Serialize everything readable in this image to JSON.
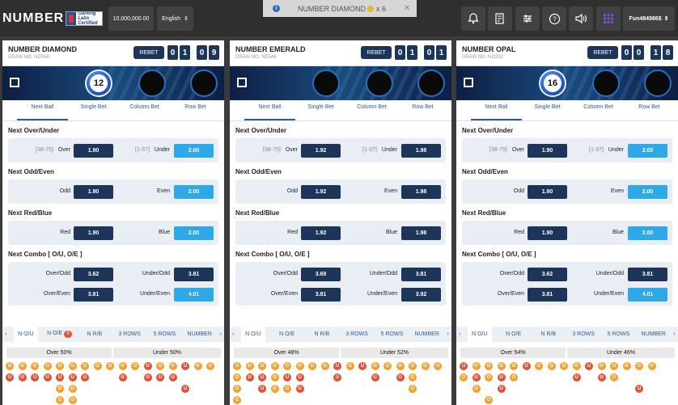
{
  "header": {
    "logo_text": "NUMBER",
    "logo_badge_lines": [
      "Gaming",
      "Labs",
      "Certified"
    ],
    "balance": "10,000,000.00",
    "language": "English",
    "username": "Fun484986$",
    "toast": {
      "text": "NUMBER DIAMOND",
      "multiplier": "x 6"
    },
    "icons": [
      "bell-icon",
      "bet-slip-icon",
      "settings-sliders-icon",
      "help-icon",
      "volume-icon",
      "grid-icon"
    ]
  },
  "tabs": [
    "Next Ball",
    "Single Bet",
    "Column Bet",
    "Row Bet"
  ],
  "sections": {
    "ou": "Next Over/Under",
    "oe": "Next Odd/Even",
    "rb": "Next Red/Blue",
    "combo": "Next Combo [ O/U, O/E ]"
  },
  "labels": {
    "over_range": "[38-75]",
    "over": "Over",
    "under_range": "[1-37]",
    "under": "Under",
    "odd": "Odd",
    "even": "Even",
    "red": "Red",
    "blue": "Blue",
    "over_odd": "Over/Odd",
    "under_odd": "Under/Odd",
    "over_even": "Over/Even",
    "under_even": "Under/Even"
  },
  "rebet": "REBET",
  "bottom_tabs": [
    "N O/U",
    "N O/E",
    "N R/B",
    "3 ROWS",
    "5 ROWS",
    "NUMBER"
  ],
  "panels": [
    {
      "name": "NUMBER DIAMOND",
      "draw_no": "DRAW NO. ND566",
      "timer": [
        "0",
        "1",
        "0",
        "9"
      ],
      "balls": [
        "12",
        "",
        ""
      ],
      "odds": {
        "over": "1.90",
        "under": "2.00",
        "odd": "1.90",
        "even": "2.00",
        "red": "1.90",
        "blue": "2.00",
        "over_odd": "3.62",
        "under_odd": "3.81",
        "over_even": "3.81",
        "under_even": "4.01"
      },
      "highlight": [
        "under",
        "even",
        "blue",
        "under_even"
      ],
      "oe_badge": "6",
      "over_stat": "Over 50%",
      "under_stat": "Under 50%",
      "beads": [
        [
          "O",
          "O",
          "O",
          "O",
          "O",
          "O",
          "O",
          "O",
          "O",
          "O",
          "O",
          "U",
          "O",
          "O",
          "U",
          "O",
          "O"
        ],
        [
          "U",
          "U",
          "U",
          "U",
          "U",
          "U",
          "U",
          "",
          "",
          "U",
          "",
          "U",
          "U",
          "U"
        ],
        [
          "",
          "",
          "",
          "",
          "O",
          "O",
          "",
          "",
          "",
          "",
          "",
          "",
          "",
          "",
          "U"
        ],
        [
          "",
          "",
          "",
          "",
          "O",
          "O"
        ]
      ]
    },
    {
      "name": "NUMBER EMERALD",
      "draw_no": "DRAW NO. NE546",
      "timer": [
        "0",
        "1",
        "0",
        "1"
      ],
      "balls": [
        "",
        "",
        ""
      ],
      "odds": {
        "over": "1.92",
        "under": "1.98",
        "odd": "1.92",
        "even": "1.98",
        "red": "1.92",
        "blue": "1.98",
        "over_odd": "3.69",
        "under_odd": "3.81",
        "over_even": "3.81",
        "under_even": "3.92"
      },
      "highlight": [],
      "oe_badge": "",
      "over_stat": "Over 48%",
      "under_stat": "Under 52%",
      "beads": [
        [
          "O",
          "O",
          "O",
          "O",
          "O",
          "O",
          "O",
          "O",
          "U",
          "O",
          "U",
          "O",
          "O",
          "O",
          "O",
          "O",
          "O"
        ],
        [
          "O",
          "U",
          "U",
          "O",
          "U",
          "U",
          "",
          "",
          "U",
          "",
          "",
          "U",
          "",
          "U",
          "O"
        ],
        [
          "O",
          "",
          "U",
          "O",
          "O",
          "U",
          "",
          "",
          "",
          "",
          "",
          "",
          "",
          "",
          "O"
        ],
        [
          "O"
        ]
      ]
    },
    {
      "name": "NUMBER OPAL",
      "draw_no": "DRAW NO. NO292",
      "timer": [
        "0",
        "0",
        "1",
        "8"
      ],
      "balls": [
        "16",
        "",
        ""
      ],
      "odds": {
        "over": "1.90",
        "under": "2.00",
        "odd": "1.90",
        "even": "2.00",
        "red": "1.90",
        "blue": "2.00",
        "over_odd": "3.62",
        "under_odd": "3.81",
        "over_even": "3.81",
        "under_even": "4.01"
      },
      "highlight": [
        "under",
        "even",
        "blue",
        "under_even"
      ],
      "oe_badge": "",
      "over_stat": "Over 54%",
      "under_stat": "Under 46%",
      "beads": [
        [
          "U",
          "O",
          "O",
          "O",
          "O",
          "U",
          "O",
          "O",
          "O",
          "O",
          "U",
          "O",
          "O",
          "O",
          "O",
          "O"
        ],
        [
          "O",
          "U",
          "O",
          "U",
          "O",
          "",
          "",
          "",
          "",
          "U",
          "",
          "U",
          "O"
        ],
        [
          "",
          "O",
          "",
          "U",
          "",
          "",
          "",
          "",
          "",
          "",
          "",
          "",
          "",
          "",
          "U"
        ],
        [
          "",
          "",
          "O"
        ]
      ]
    }
  ]
}
